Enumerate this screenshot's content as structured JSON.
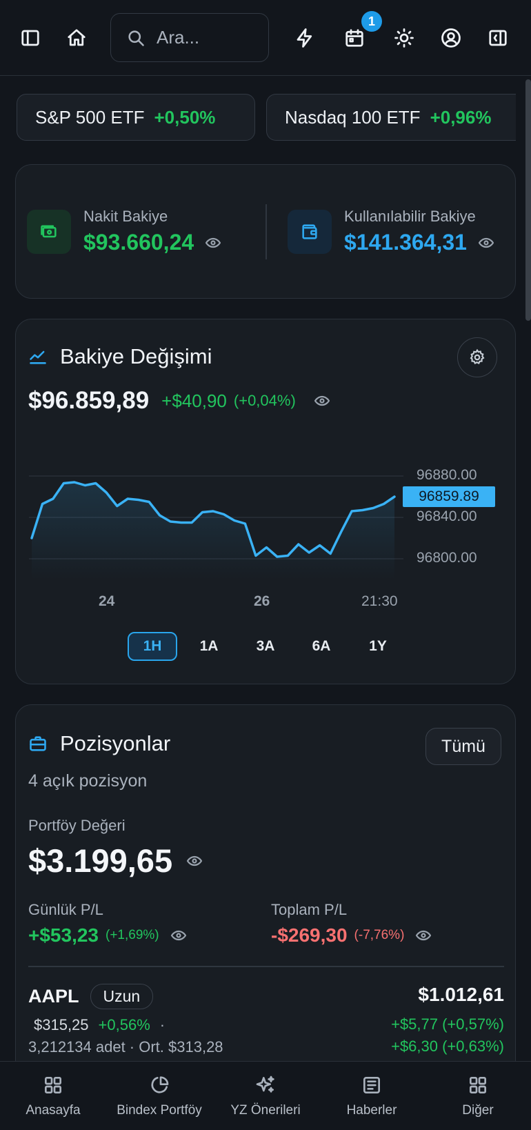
{
  "topbar": {
    "search_placeholder": "Ara...",
    "notification_count": "1"
  },
  "tickers": [
    {
      "name": "S&P 500 ETF",
      "change": "+0,50%"
    },
    {
      "name": "Nasdaq 100 ETF",
      "change": "+0,96%"
    }
  ],
  "balances": {
    "cash_label": "Nakit Bakiye",
    "cash_value": "$93.660,24",
    "available_label": "Kullanılabilir Bakiye",
    "available_value": "$141.364,31"
  },
  "balance_change": {
    "title": "Bakiye Değişimi",
    "value": "$96.859,89",
    "change": "+$40,90",
    "change_pct": "(+0,04%)",
    "ranges": [
      "1H",
      "1A",
      "3A",
      "6A",
      "1Y"
    ],
    "active_range": "1H"
  },
  "chart_data": {
    "type": "line",
    "title": "",
    "xlabel": "",
    "ylabel": "",
    "x_ticks": [
      "24",
      "26",
      "21:30"
    ],
    "y_ticks": [
      "96880.00",
      "96840.00",
      "96800.00"
    ],
    "ylim": [
      96780,
      96900
    ],
    "current_value_label": "96859.89",
    "grid": true,
    "series": [
      {
        "values": [
          96820,
          96853,
          96858,
          96873,
          96874,
          96871,
          96873,
          96864,
          96851,
          96858,
          96857,
          96855,
          96842,
          96836,
          96835,
          96835,
          96845,
          96846,
          96843,
          96837,
          96834,
          96803,
          96811,
          96802,
          96803,
          96814,
          96806,
          96813,
          96805,
          96826,
          96846,
          96847,
          96849,
          96853,
          96860
        ]
      }
    ],
    "colors": {
      "line": "#3ab2f5",
      "marker_bg": "#3ab2f5"
    }
  },
  "positions": {
    "title": "Pozisyonlar",
    "subtitle": "4 açık pozisyon",
    "all_button": "Tümü",
    "portfolio_label": "Portföy Değeri",
    "portfolio_value": "$3.199,65",
    "daily_label": "Günlük P/L",
    "daily_value": "+$53,23",
    "daily_pct": "(+1,69%)",
    "total_label": "Toplam P/L",
    "total_value": "-$269,30",
    "total_pct": "(-7,76%)",
    "items": [
      {
        "symbol": "AAPL",
        "side": "Uzun",
        "price": "$315,25",
        "price_chg": "+0,56%",
        "dot": "·",
        "qty_line": "3,212134 adet · Ort. $313,28",
        "value": "$1.012,61",
        "daily": "+$5,77 (+0,57%)",
        "total": "+$6,30 (+0,63%)"
      }
    ]
  },
  "bottom_nav": [
    {
      "label": "Anasayfa",
      "icon": "grid-icon"
    },
    {
      "label": "Bindex Portföy",
      "icon": "pie-chart-icon"
    },
    {
      "label": "YZ Önerileri",
      "icon": "sparkles-icon"
    },
    {
      "label": "Haberler",
      "icon": "newspaper-icon"
    },
    {
      "label": "Diğer",
      "icon": "apps-icon"
    }
  ],
  "colors": {
    "green": "#22c55e",
    "blue": "#2ea8f0",
    "red": "#f87171",
    "background": "#12161c",
    "card": "#181d23"
  }
}
